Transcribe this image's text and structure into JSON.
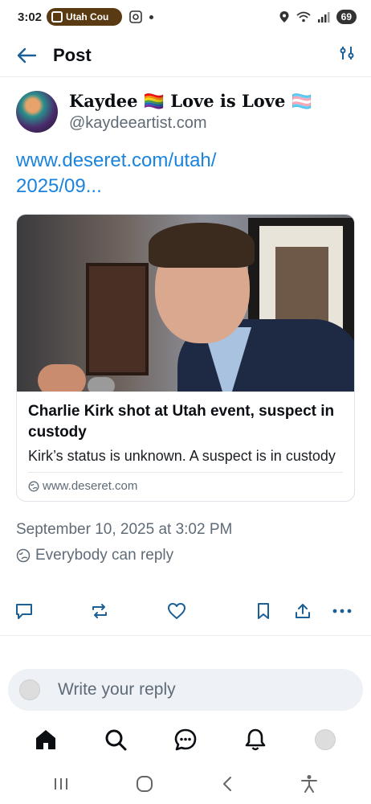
{
  "status_bar": {
    "time": "3:02",
    "notification_chip": "Utah Cou",
    "battery": "69",
    "icons": [
      "app-notification-icon",
      "screenshot-icon",
      "dot-icon",
      "location-icon",
      "wifi-icon",
      "signal-icon"
    ]
  },
  "header": {
    "title": "Post",
    "back_icon": "arrow-left-icon",
    "settings_icon": "sliders-icon"
  },
  "post": {
    "author": {
      "display_name": "Kaydee 🏳️‍🌈 Love is Love 🏳️‍⚧️",
      "handle": "@kaydeeartist.com"
    },
    "link_text": "www.deseret.com/utah/ 2025/09...",
    "card": {
      "title": "Charlie Kirk shot at Utah event, suspect in custody",
      "description": "Kirk’s status is unknown. A suspect is in custody",
      "domain": "www.deseret.com"
    },
    "timestamp": "September 10, 2025 at 3:02 PM",
    "reply_setting": "Everybody can reply"
  },
  "actions": [
    {
      "name": "reply-button",
      "icon": "speech-bubble-icon"
    },
    {
      "name": "repost-button",
      "icon": "repost-icon"
    },
    {
      "name": "like-button",
      "icon": "heart-icon"
    },
    {
      "name": "bookmark-button",
      "icon": "bookmark-icon"
    },
    {
      "name": "share-button",
      "icon": "share-icon"
    },
    {
      "name": "more-button",
      "icon": "ellipsis-icon"
    }
  ],
  "reply_bar": {
    "placeholder": "Write your reply"
  },
  "bottom_nav": [
    "home-icon",
    "search-icon",
    "chat-icon",
    "bell-icon",
    "profile-avatar"
  ],
  "system_nav": [
    "recents-icon",
    "home-circle-icon",
    "back-chevron-icon",
    "accessibility-icon"
  ],
  "colors": {
    "link": "#1a83dd",
    "muted_text": "#5f6b77",
    "status_chip": "#5a3a12"
  }
}
